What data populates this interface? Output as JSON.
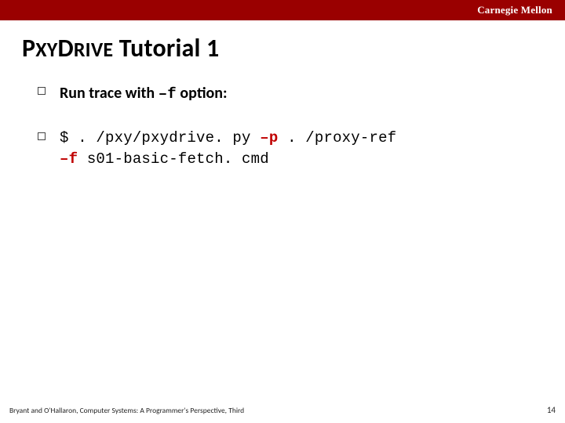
{
  "brand": "Carnegie Mellon",
  "title": {
    "word1_caps": "P",
    "word1_rest": "XY",
    "word2_caps": "D",
    "word2_rest": "RIVE",
    "tail": " Tutorial 1"
  },
  "bullets": [
    {
      "pre": "Run trace with ",
      "flag": "–f",
      "post": " option:"
    }
  ],
  "command": {
    "line1_pre": "$ . /pxy/pxydrive. py ",
    "line1_flag": "–p",
    "line1_post": " . /proxy-ref",
    "line2_flag": "–f",
    "line2_post": " s01-basic-fetch. cmd"
  },
  "footer_text": "Bryant and O'Hallaron, Computer Systems: A Programmer's Perspective, Third",
  "page_number": "14"
}
